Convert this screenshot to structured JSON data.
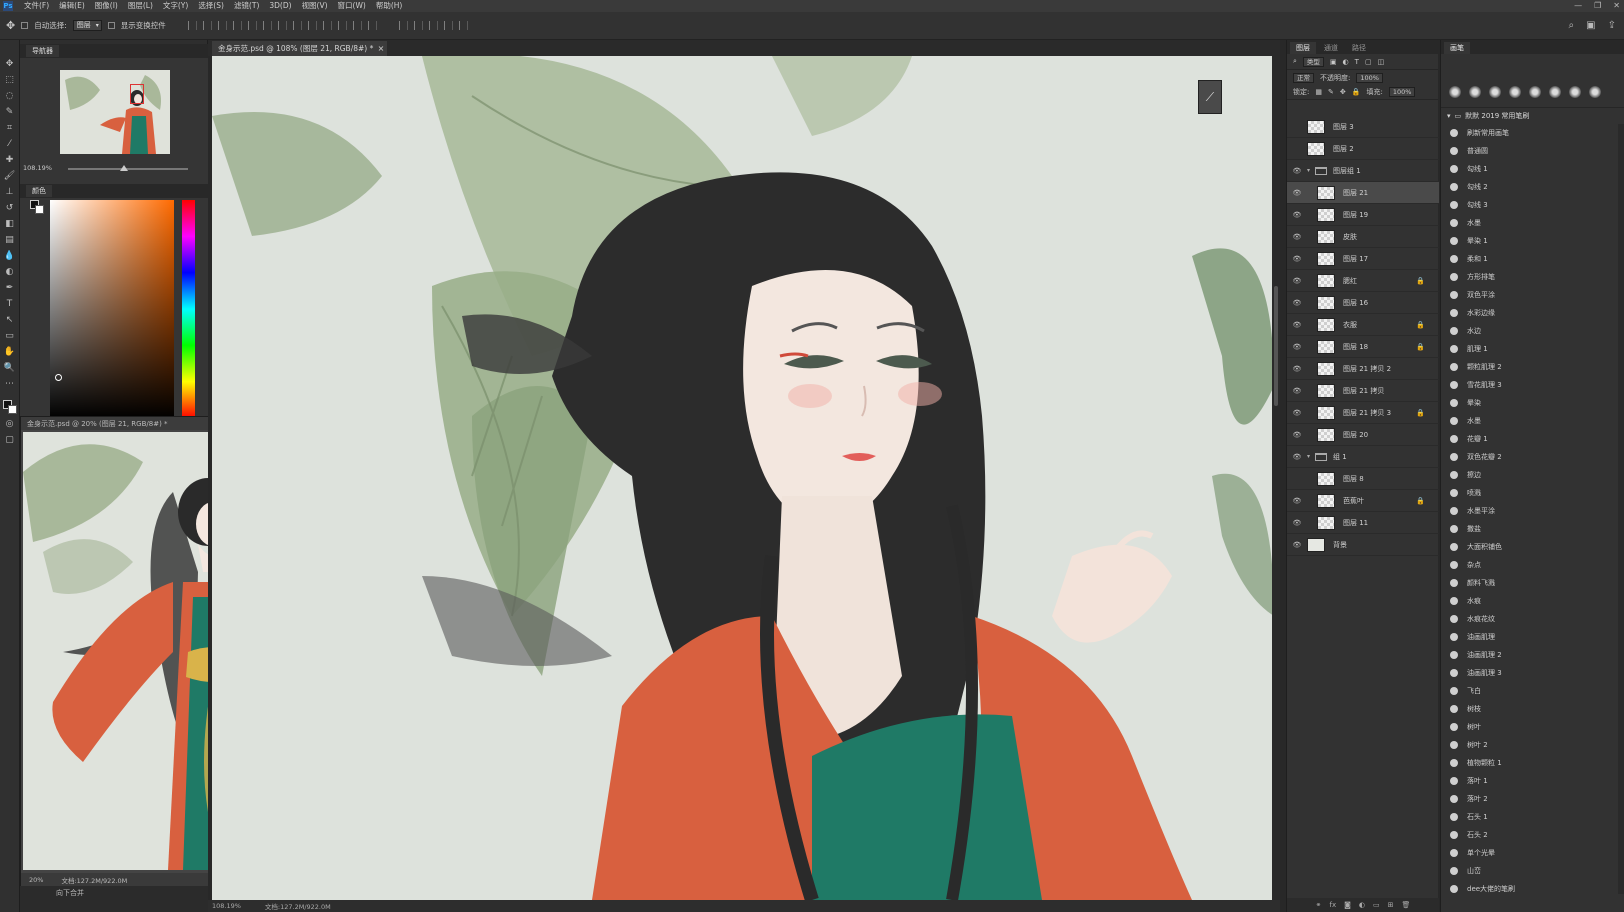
{
  "menubar": {
    "items": [
      "文件(F)",
      "编辑(E)",
      "图像(I)",
      "图层(L)",
      "文字(Y)",
      "选择(S)",
      "滤镜(T)",
      "3D(D)",
      "视图(V)",
      "窗口(W)",
      "帮助(H)"
    ],
    "window_controls": [
      "—",
      "❐",
      "✕"
    ]
  },
  "options": {
    "auto_select_label": "自动选择:",
    "auto_select_value": "图层",
    "show_transform_label": "显示变换控件"
  },
  "navigator": {
    "tab": "导航器",
    "zoom": "108.19%"
  },
  "color_panel": {
    "tab": "颜色"
  },
  "document": {
    "tab_title": "金身示范.psd @ 108% (图层 21, RGB/8#) *",
    "status_zoom": "108.19%",
    "status_doc": "文档:127.2M/922.0M"
  },
  "float_window": {
    "title": "金身示范.psd @ 20% (图层 21, RGB/8#) *",
    "zoom": "20%",
    "doc": "文档:127.2M/922.0M",
    "merge_label": "向下合并"
  },
  "layers_panel": {
    "tabs": [
      "图层",
      "通道",
      "路径"
    ],
    "filter_label": "类型",
    "blend_mode": "正常",
    "opacity_label": "不透明度:",
    "opacity_value": "100%",
    "lock_label": "锁定:",
    "fill_label": "填充:",
    "fill_value": "100%",
    "layers": [
      {
        "name": "图层 3",
        "eye": false,
        "kind": "layer",
        "indent": 0,
        "locked": false,
        "active": false
      },
      {
        "name": "图层 2",
        "eye": false,
        "kind": "layer",
        "indent": 0,
        "locked": false,
        "active": false
      },
      {
        "name": "图层组 1",
        "eye": true,
        "kind": "folder",
        "indent": 0,
        "locked": false,
        "active": false
      },
      {
        "name": "图层 21",
        "eye": true,
        "kind": "layer",
        "indent": 1,
        "locked": false,
        "active": true
      },
      {
        "name": "图层 19",
        "eye": true,
        "kind": "layer",
        "indent": 1,
        "locked": false,
        "active": false
      },
      {
        "name": "皮肤",
        "eye": true,
        "kind": "layer",
        "indent": 1,
        "locked": false,
        "active": false
      },
      {
        "name": "图层 17",
        "eye": true,
        "kind": "layer",
        "indent": 1,
        "locked": false,
        "active": false
      },
      {
        "name": "腮红",
        "eye": true,
        "kind": "layer",
        "indent": 1,
        "locked": true,
        "active": false
      },
      {
        "name": "图层 16",
        "eye": true,
        "kind": "layer",
        "indent": 1,
        "locked": false,
        "active": false
      },
      {
        "name": "衣服",
        "eye": true,
        "kind": "layer",
        "indent": 1,
        "locked": true,
        "active": false
      },
      {
        "name": "图层 18",
        "eye": true,
        "kind": "layer",
        "indent": 1,
        "locked": true,
        "active": false
      },
      {
        "name": "图层 21 拷贝 2",
        "eye": true,
        "kind": "layer",
        "indent": 1,
        "locked": false,
        "active": false
      },
      {
        "name": "图层 21 拷贝",
        "eye": true,
        "kind": "layer",
        "indent": 1,
        "locked": false,
        "active": false
      },
      {
        "name": "图层 21 拷贝 3",
        "eye": true,
        "kind": "layer",
        "indent": 1,
        "locked": true,
        "active": false
      },
      {
        "name": "图层 20",
        "eye": true,
        "kind": "layer",
        "indent": 1,
        "locked": false,
        "active": false
      },
      {
        "name": "组 1",
        "eye": true,
        "kind": "folder",
        "indent": 0,
        "locked": false,
        "active": false
      },
      {
        "name": "图层 8",
        "eye": false,
        "kind": "layer",
        "indent": 1,
        "locked": false,
        "active": false
      },
      {
        "name": "芭蕉叶",
        "eye": true,
        "kind": "layer",
        "indent": 1,
        "locked": true,
        "active": false
      },
      {
        "name": "图层 11",
        "eye": true,
        "kind": "layer",
        "indent": 1,
        "locked": false,
        "active": false
      },
      {
        "name": "背景",
        "eye": true,
        "kind": "background",
        "indent": 0,
        "locked": false,
        "active": false
      }
    ],
    "footer_icons": [
      "link-icon",
      "fx-icon",
      "mask-icon",
      "adjustment-icon",
      "folder-icon",
      "new-layer-icon",
      "trash-icon"
    ]
  },
  "brush_panel": {
    "tab": "画笔",
    "group_name": "默默 2019 常用笔刷",
    "brushes": [
      "刷新常用画笔",
      "普通圆",
      "勾线 1",
      "勾线 2",
      "勾线 3",
      "水墨",
      "晕染 1",
      "柔和 1",
      "方形排笔",
      "双色平涂",
      "水彩边缘",
      "水边",
      "肌理 1",
      "颗粒肌理 2",
      "雪花肌理 3",
      "晕染",
      "水墨",
      "花瓣 1",
      "双色花瓣 2",
      "擦边",
      "喷溅",
      "水墨平涂",
      "撒盐",
      "大面积铺色",
      "杂点",
      "颜料飞溅",
      "水痕",
      "水痕花纹",
      "油画肌理",
      "油画肌理 2",
      "油画肌理 3",
      "飞白",
      "树枝",
      "树叶",
      "树叶 2",
      "植物颗粒 1",
      "落叶 1",
      "落叶 2",
      "石头 1",
      "石头 2",
      "单个光晕",
      "山峦",
      "dee大佬的笔刷"
    ]
  },
  "colors": {
    "hair": "#2a2a2a",
    "robe": "#d8603f",
    "dress": "#1f7a66",
    "leaf": "#9fb08e",
    "canvas_bg": "#dde2dc"
  }
}
